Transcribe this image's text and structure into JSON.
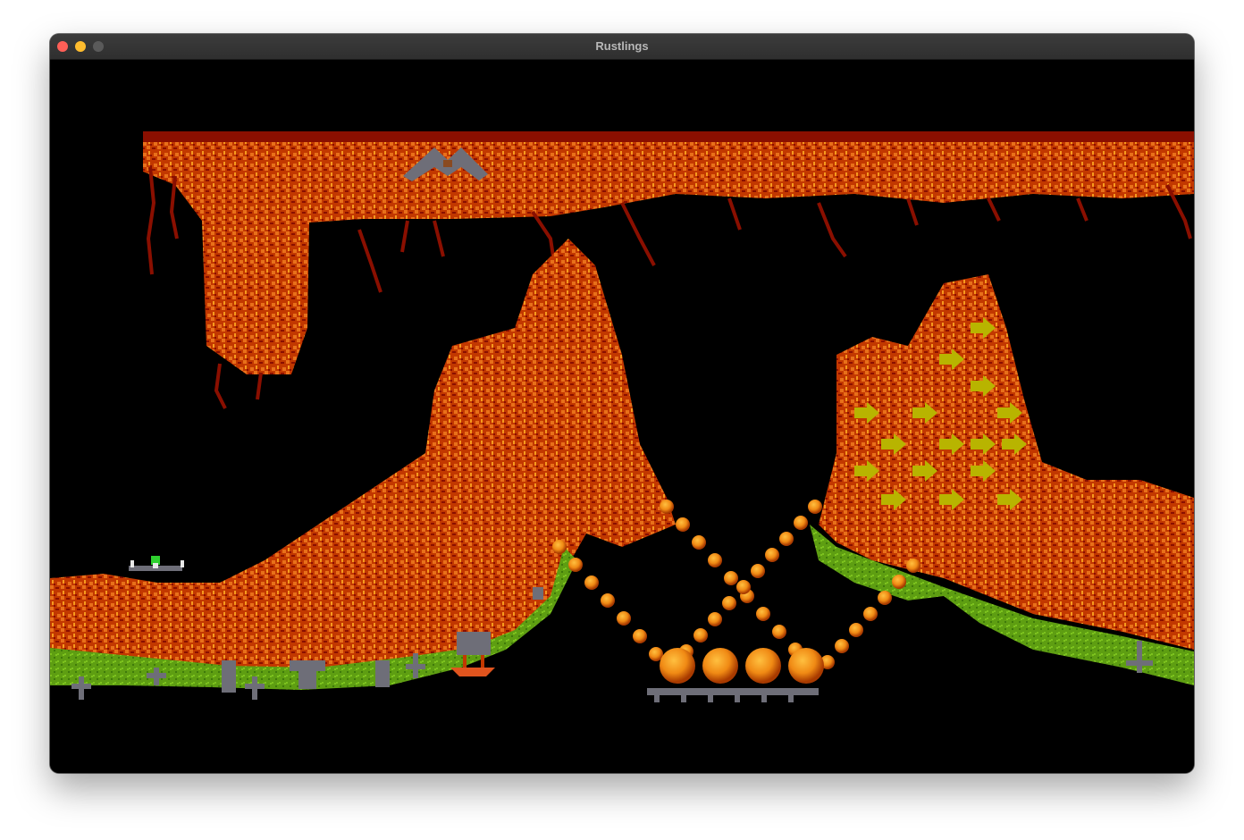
{
  "window": {
    "title": "Rustlings"
  },
  "game": {
    "palette": {
      "background": "#000000",
      "rock_dark": "#8a0f00",
      "rock_mid": "#c23800",
      "rock_light": "#e8701a",
      "rock_highlight": "#f59a1e",
      "grass": "#5e9e12",
      "grass_light": "#7cc21e",
      "stone": "#6e6e78",
      "arrow": "#b8b400",
      "orb": "#f08a14"
    },
    "objects": [
      {
        "name": "lemming",
        "kind": "green-haired walker"
      },
      {
        "name": "entrance-hatch",
        "kind": "trapdoor"
      },
      {
        "name": "exit-basket",
        "kind": "exit"
      },
      {
        "name": "one-way-arrows",
        "kind": "directional wall",
        "direction": "right"
      },
      {
        "name": "orb-bridges",
        "kind": "chains of orbs"
      },
      {
        "name": "gravestones",
        "kind": "decoration"
      }
    ]
  }
}
